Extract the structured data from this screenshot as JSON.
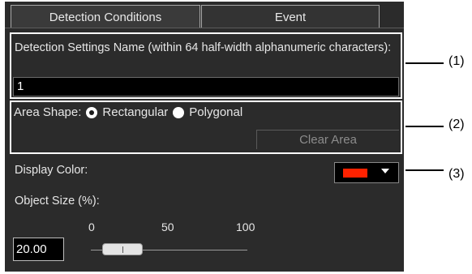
{
  "tabs": [
    {
      "label": "Detection Conditions",
      "active": true
    },
    {
      "label": "Event",
      "active": false
    }
  ],
  "detection_name": {
    "label": "Detection Settings Name (within 64 half-width alphanumeric characters):",
    "value": "1"
  },
  "area_shape": {
    "label": "Area Shape:",
    "options": [
      {
        "label": "Rectangular",
        "selected": true
      },
      {
        "label": "Polygonal",
        "selected": false
      }
    ],
    "clear_label": "Clear Area"
  },
  "display_color": {
    "label": "Display Color:",
    "value_color": "#ff2200"
  },
  "object_size": {
    "label": "Object Size (%):",
    "value": "20.00",
    "slider_ticks": [
      "0",
      "50",
      "100"
    ],
    "slider_fraction": 0.2
  },
  "callouts": [
    "(1)",
    "(2)",
    "(3)"
  ]
}
